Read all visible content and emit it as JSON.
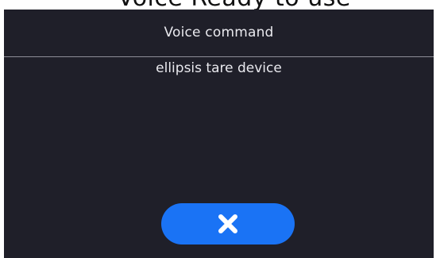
{
  "header_partial": {
    "text": "Voice Ready to use"
  },
  "dialog": {
    "title": "Voice command",
    "command": "ellipsis tare device"
  },
  "cancel_button": {
    "icon": "close-icon",
    "color": "#1a73f5"
  },
  "colors": {
    "dialog_background": "#1f1f29",
    "divider": "#8d8d98",
    "text": "#e9e9ee"
  }
}
